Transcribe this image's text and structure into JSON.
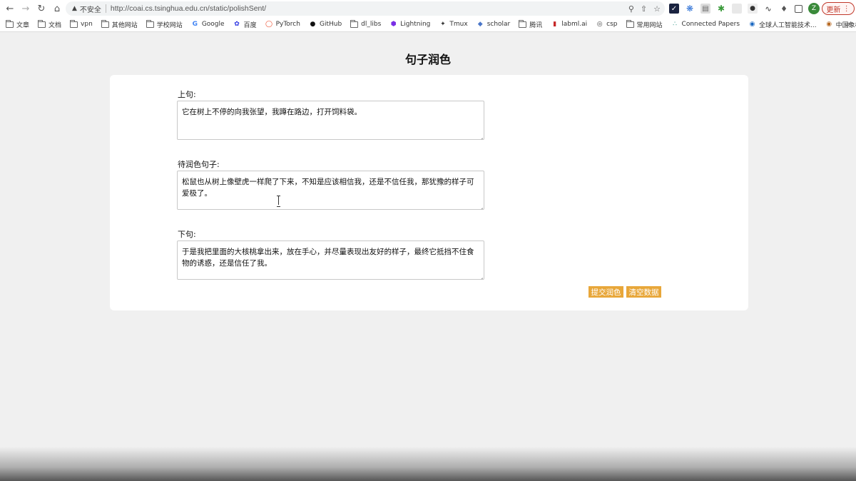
{
  "browser": {
    "security_label": "不安全",
    "url": "http://coai.cs.tsinghua.edu.cn/static/polishSent/",
    "update_label": "更新",
    "avatar_letter": "Z"
  },
  "bookmarks": [
    {
      "label": "文章",
      "icon": "folder-icon"
    },
    {
      "label": "文档",
      "icon": "folder-icon"
    },
    {
      "label": "vpn",
      "icon": "folder-icon"
    },
    {
      "label": "其他网站",
      "icon": "folder-icon"
    },
    {
      "label": "学校网站",
      "icon": "folder-icon"
    },
    {
      "label": "Google",
      "icon": "google-icon"
    },
    {
      "label": "百度",
      "icon": "baidu-icon"
    },
    {
      "label": "PyTorch",
      "icon": "pytorch-icon"
    },
    {
      "label": "GitHub",
      "icon": "github-icon"
    },
    {
      "label": "dl_libs",
      "icon": "folder-icon"
    },
    {
      "label": "Lightning",
      "icon": "lightning-icon"
    },
    {
      "label": "Tmux",
      "icon": "tmux-icon"
    },
    {
      "label": "scholar",
      "icon": "scholar-icon"
    },
    {
      "label": "腾讯",
      "icon": "folder-icon"
    },
    {
      "label": "labml.ai",
      "icon": "labml-icon"
    },
    {
      "label": "csp",
      "icon": "globe-icon"
    },
    {
      "label": "常用网站",
      "icon": "folder-icon"
    },
    {
      "label": "Connected Papers",
      "icon": "connected-papers-icon"
    },
    {
      "label": "全球人工智能技术...",
      "icon": "ai-icon"
    },
    {
      "label": "中国象棋云库查询",
      "icon": "chess-icon"
    }
  ],
  "page": {
    "title": "句子润色",
    "prev_label": "上句:",
    "prev_text": "它在树上不停的向我张望，我蹲在路边，打开饲料袋。",
    "target_label": "待润色句子:",
    "target_text": "松鼠也从树上像壁虎一样爬了下来，不知是应该相信我，还是不信任我，那犹豫的样子可爱极了。",
    "next_label": "下句:",
    "next_text": "于是我把里面的大核桃拿出来，放在手心，并尽量表现出友好的样子，最终它抵挡不住食物的诱惑，还是信任了我。",
    "submit_label": "提交润色",
    "clear_label": "清空数据"
  },
  "colors": {
    "button_bg": "#e8a73a",
    "page_bg": "#f0f0f0",
    "update_red": "#c0392b"
  }
}
